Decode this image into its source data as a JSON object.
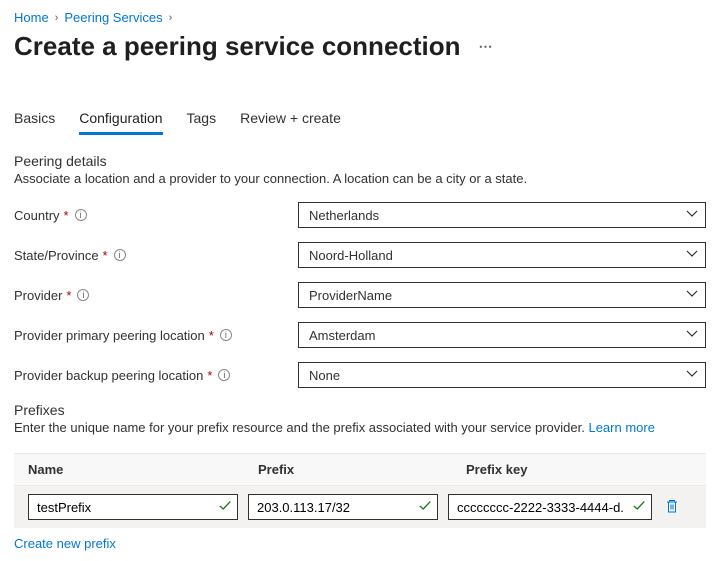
{
  "breadcrumb": {
    "home": "Home",
    "peering_services": "Peering Services"
  },
  "title": "Create a peering service connection",
  "tabs": {
    "basics": "Basics",
    "configuration": "Configuration",
    "tags": "Tags",
    "review": "Review + create"
  },
  "details": {
    "heading": "Peering details",
    "sub": "Associate a location and a provider to your connection. A location can be a city or a state."
  },
  "form": {
    "country_label": "Country",
    "country_value": "Netherlands",
    "state_label": "State/Province",
    "state_value": "Noord-Holland",
    "provider_label": "Provider",
    "provider_value": "ProviderName",
    "primary_label": "Provider primary peering location",
    "primary_value": "Amsterdam",
    "backup_label": "Provider backup peering location",
    "backup_value": "None"
  },
  "prefixes": {
    "heading": "Prefixes",
    "sub_a": "Enter the unique name for your prefix resource and the prefix associated with your service provider. ",
    "learn_more": "Learn more",
    "col_name": "Name",
    "col_prefix": "Prefix",
    "col_key": "Prefix key",
    "row": {
      "name": "testPrefix",
      "prefix": "203.0.113.17/32",
      "key": "cccccccc-2222-3333-4444-d..."
    },
    "create_new": "Create new prefix"
  }
}
